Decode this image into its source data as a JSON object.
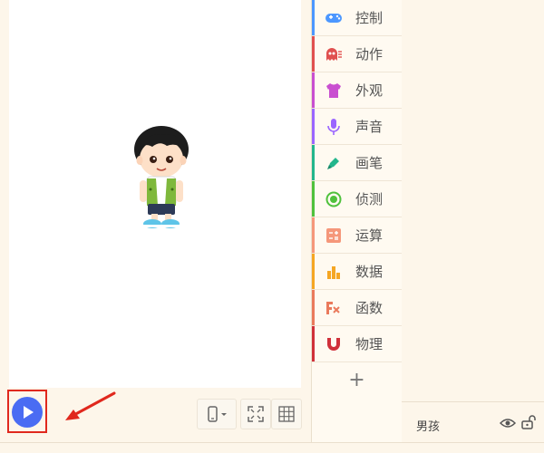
{
  "categories": [
    {
      "label": "控制",
      "color": "#4c97ff",
      "icon": "gamepad-icon"
    },
    {
      "label": "动作",
      "color": "#e0504f",
      "icon": "ghost-icon"
    },
    {
      "label": "外观",
      "color": "#c94fd0",
      "icon": "shirt-icon"
    },
    {
      "label": "声音",
      "color": "#9b66ff",
      "icon": "microphone-icon"
    },
    {
      "label": "画笔",
      "color": "#22b68c",
      "icon": "pen-icon"
    },
    {
      "label": "侦测",
      "color": "#4fc13c",
      "icon": "target-icon"
    },
    {
      "label": "运算",
      "color": "#f5977a",
      "icon": "calculator-icon"
    },
    {
      "label": "数据",
      "color": "#f5a623",
      "icon": "bar-chart-icon"
    },
    {
      "label": "函数",
      "color": "#ea7a5c",
      "icon": "function-icon"
    },
    {
      "label": "物理",
      "color": "#d0303a",
      "icon": "magnet-icon"
    }
  ],
  "add_symbol": "+",
  "sprite": {
    "name": "男孩"
  },
  "colors": {
    "play": "#4a6cf3",
    "highlight": "#e0281d"
  }
}
